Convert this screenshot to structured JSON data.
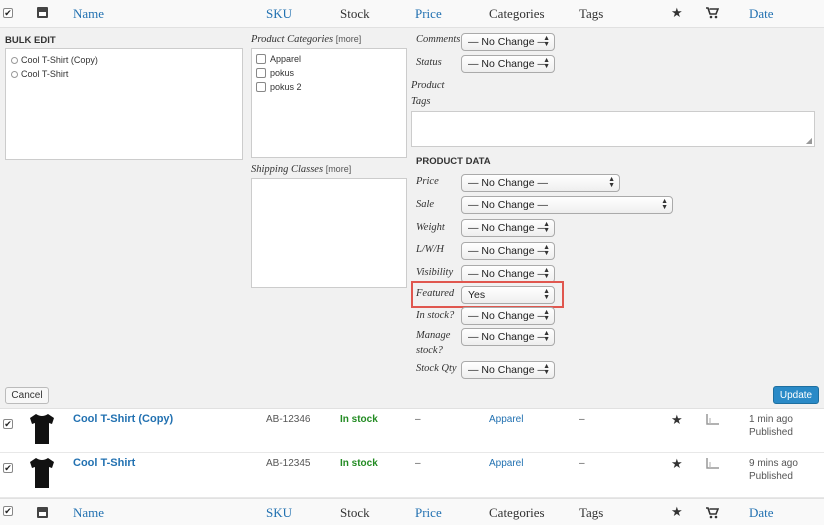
{
  "columns": {
    "name": "Name",
    "sku": "SKU",
    "stock": "Stock",
    "price": "Price",
    "categories": "Categories",
    "tags": "Tags",
    "date": "Date"
  },
  "bulk_edit": {
    "title": "BULK EDIT",
    "items": [
      "Cool T-Shirt (Copy)",
      "Cool T-Shirt"
    ]
  },
  "product_categories": {
    "label": "Product Categories",
    "more": "[more]",
    "items": [
      "Apparel",
      "pokus",
      "pokus 2"
    ]
  },
  "shipping_classes": {
    "label": "Shipping Classes",
    "more": "[more]"
  },
  "fields": {
    "comments_label": "Comments",
    "comments_value": "— No Change —",
    "status_label": "Status",
    "status_value": "— No Change —",
    "product_tags_label_1": "Product",
    "product_tags_label_2": "Tags"
  },
  "product_data": {
    "title": "PRODUCT DATA",
    "price_label": "Price",
    "price_value": "— No Change —",
    "sale_label": "Sale",
    "sale_value": "— No Change —",
    "weight_label": "Weight",
    "weight_value": "— No Change —",
    "lwh_label": "L/W/H",
    "lwh_value": "— No Change —",
    "visibility_label": "Visibility",
    "visibility_value": "— No Change —",
    "featured_label": "Featured",
    "featured_value": "Yes",
    "instock_label": "In stock?",
    "instock_value": "— No Change —",
    "manage_label_1": "Manage",
    "manage_label_2": "stock?",
    "manage_value": "— No Change —",
    "stockqty_label": "Stock Qty",
    "stockqty_value": "— No Change —"
  },
  "buttons": {
    "cancel": "Cancel",
    "update": "Update"
  },
  "rows": [
    {
      "name": "Cool T-Shirt (Copy)",
      "sku": "AB-12346",
      "stock": "In stock",
      "price": "–",
      "category": "Apparel",
      "tags": "–",
      "date_1": "1 min ago",
      "date_2": "Published"
    },
    {
      "name": "Cool T-Shirt",
      "sku": "AB-12345",
      "stock": "In stock",
      "price": "–",
      "category": "Apparel",
      "tags": "–",
      "date_1": "9 mins ago",
      "date_2": "Published"
    }
  ],
  "colors": {
    "link": "#2271b1",
    "instock": "#228b22",
    "highlight": "#e0574f",
    "update_button": "#2a8ac7"
  }
}
